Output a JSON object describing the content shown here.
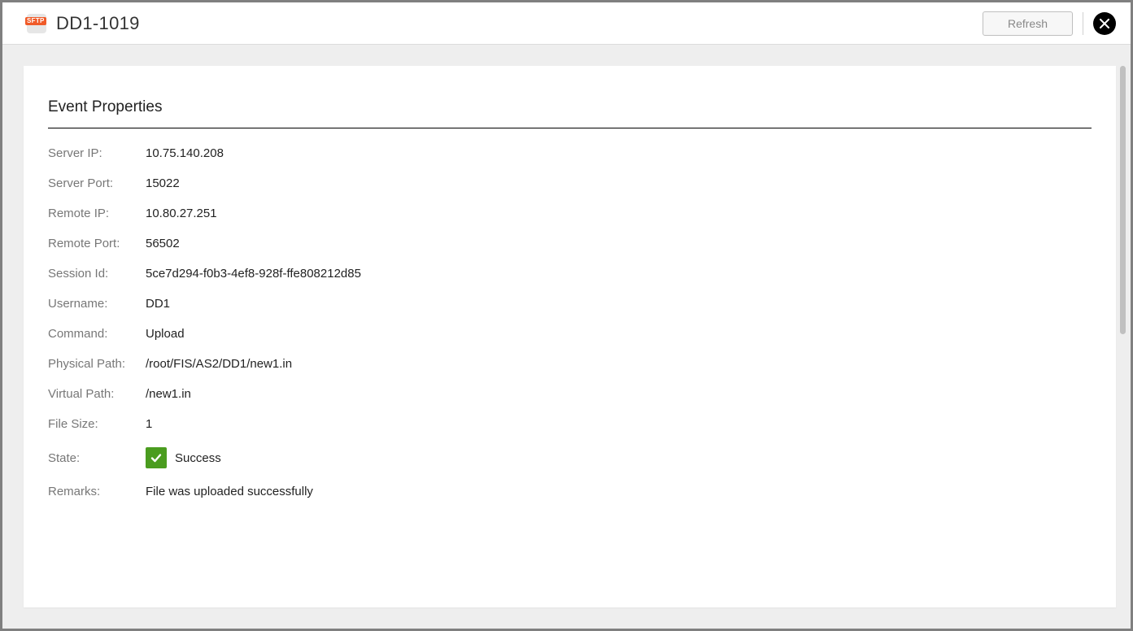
{
  "header": {
    "icon_text": "SFTP",
    "title": "DD1-1019",
    "refresh_label": "Refresh"
  },
  "section_title": "Event Properties",
  "properties": {
    "server_ip": {
      "label": "Server IP:",
      "value": "10.75.140.208"
    },
    "server_port": {
      "label": "Server Port:",
      "value": "15022"
    },
    "remote_ip": {
      "label": "Remote IP:",
      "value": "10.80.27.251"
    },
    "remote_port": {
      "label": "Remote Port:",
      "value": "56502"
    },
    "session_id": {
      "label": "Session Id:",
      "value": "5ce7d294-f0b3-4ef8-928f-ffe808212d85"
    },
    "username": {
      "label": "Username:",
      "value": "DD1"
    },
    "command": {
      "label": "Command:",
      "value": "Upload"
    },
    "physical_path": {
      "label": "Physical Path:",
      "value": "/root/FIS/AS2/DD1/new1.in"
    },
    "virtual_path": {
      "label": "Virtual Path:",
      "value": "/new1.in"
    },
    "file_size": {
      "label": "File Size:",
      "value": "1"
    },
    "state": {
      "label": "State:",
      "value": "Success"
    },
    "remarks": {
      "label": "Remarks:",
      "value": "File was uploaded successfully"
    }
  }
}
